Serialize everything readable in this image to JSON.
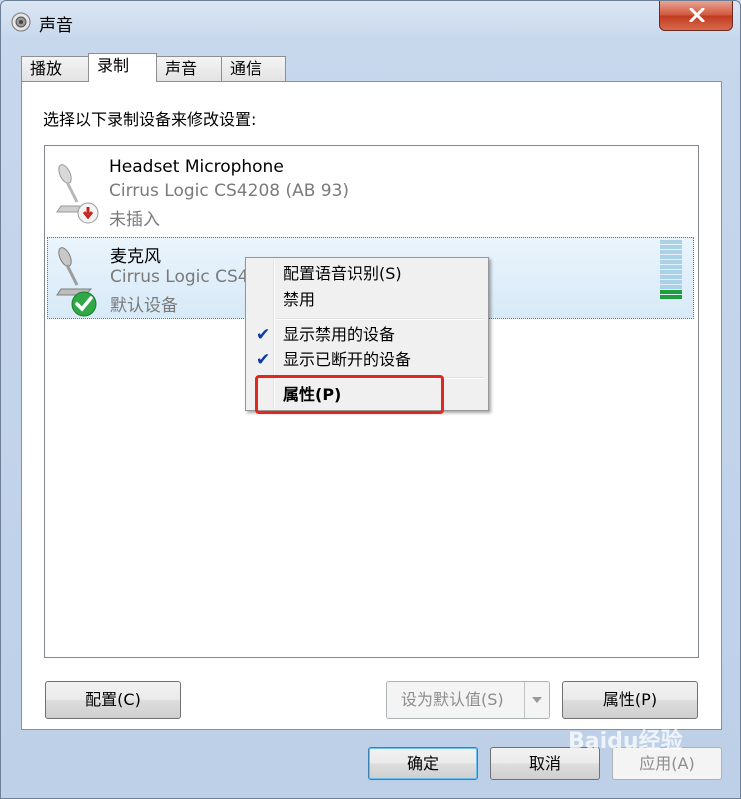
{
  "window": {
    "title": "声音",
    "icon": "speaker-icon"
  },
  "tabs": [
    {
      "label": "播放",
      "active": false
    },
    {
      "label": "录制",
      "active": true
    },
    {
      "label": "声音",
      "active": false
    },
    {
      "label": "通信",
      "active": false
    }
  ],
  "instruction": "选择以下录制设备来修改设置:",
  "devices": [
    {
      "name": "Headset Microphone",
      "driver": "Cirrus Logic CS4208 (AB 93)",
      "status": "未插入",
      "status_icon": "unplugged-arrow-icon",
      "selected": false
    },
    {
      "name": "麦克风",
      "driver": "Cirrus Logic CS4208 (AB 93)",
      "status": "默认设备",
      "status_icon": "default-check-icon",
      "selected": true,
      "level_fraction": 0.15
    }
  ],
  "context_menu": {
    "items": [
      {
        "label": "配置语音识别(S)",
        "checked": false
      },
      {
        "label": "禁用",
        "checked": false
      },
      {
        "label": "显示禁用的设备",
        "checked": true
      },
      {
        "label": "显示已断开的设备",
        "checked": true
      },
      {
        "label": "属性(P)",
        "checked": false,
        "bold": true,
        "highlighted": true
      }
    ]
  },
  "buttons": {
    "configure": "配置(C)",
    "set_default": "设为默认值(S)",
    "properties": "属性(P)",
    "ok": "确定",
    "cancel": "取消",
    "apply": "应用(A)"
  },
  "colors": {
    "highlight_border": "#e0281f",
    "check": "#0c3aa8",
    "level_on": "#1f9f3b"
  },
  "watermark": "Baidu经验"
}
